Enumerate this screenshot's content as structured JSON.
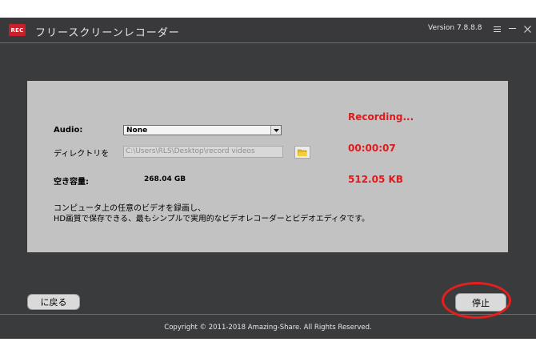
{
  "app": {
    "logo_text": "REC",
    "title": "フリースクリーンレコーダー",
    "version": "Version 7.8.8.8"
  },
  "window_controls": [
    {
      "name": "menu-icon"
    },
    {
      "name": "minimize-icon"
    },
    {
      "name": "close-icon"
    }
  ],
  "form": {
    "audio_label": "Audio:",
    "audio_value": "None",
    "directory_label": "ディレクトリを",
    "directory_path": "C:\\Users\\RLS\\Desktop\\record videos",
    "free_space_label": "空き容量:",
    "free_space_value": "268.04 GB",
    "description_line1": "コンピュータ上の任意のビデオを録画し、",
    "description_line2": "HD画質で保存できる、最もシンプルで実用的なビデオレコーダーとビデオエディタです。"
  },
  "status": {
    "recording_text": "Recording...",
    "elapsed_time": "00:00:07",
    "file_size": "512.05 KB",
    "color": "#e2191c"
  },
  "buttons": {
    "back_label": "に戻る",
    "stop_label": "停止"
  },
  "footer": {
    "copyright": "Copyright © 2011-2018 Amazing-Share. All Rights Reserved."
  },
  "annotation": {
    "highlight_color": "#e51e1e"
  }
}
